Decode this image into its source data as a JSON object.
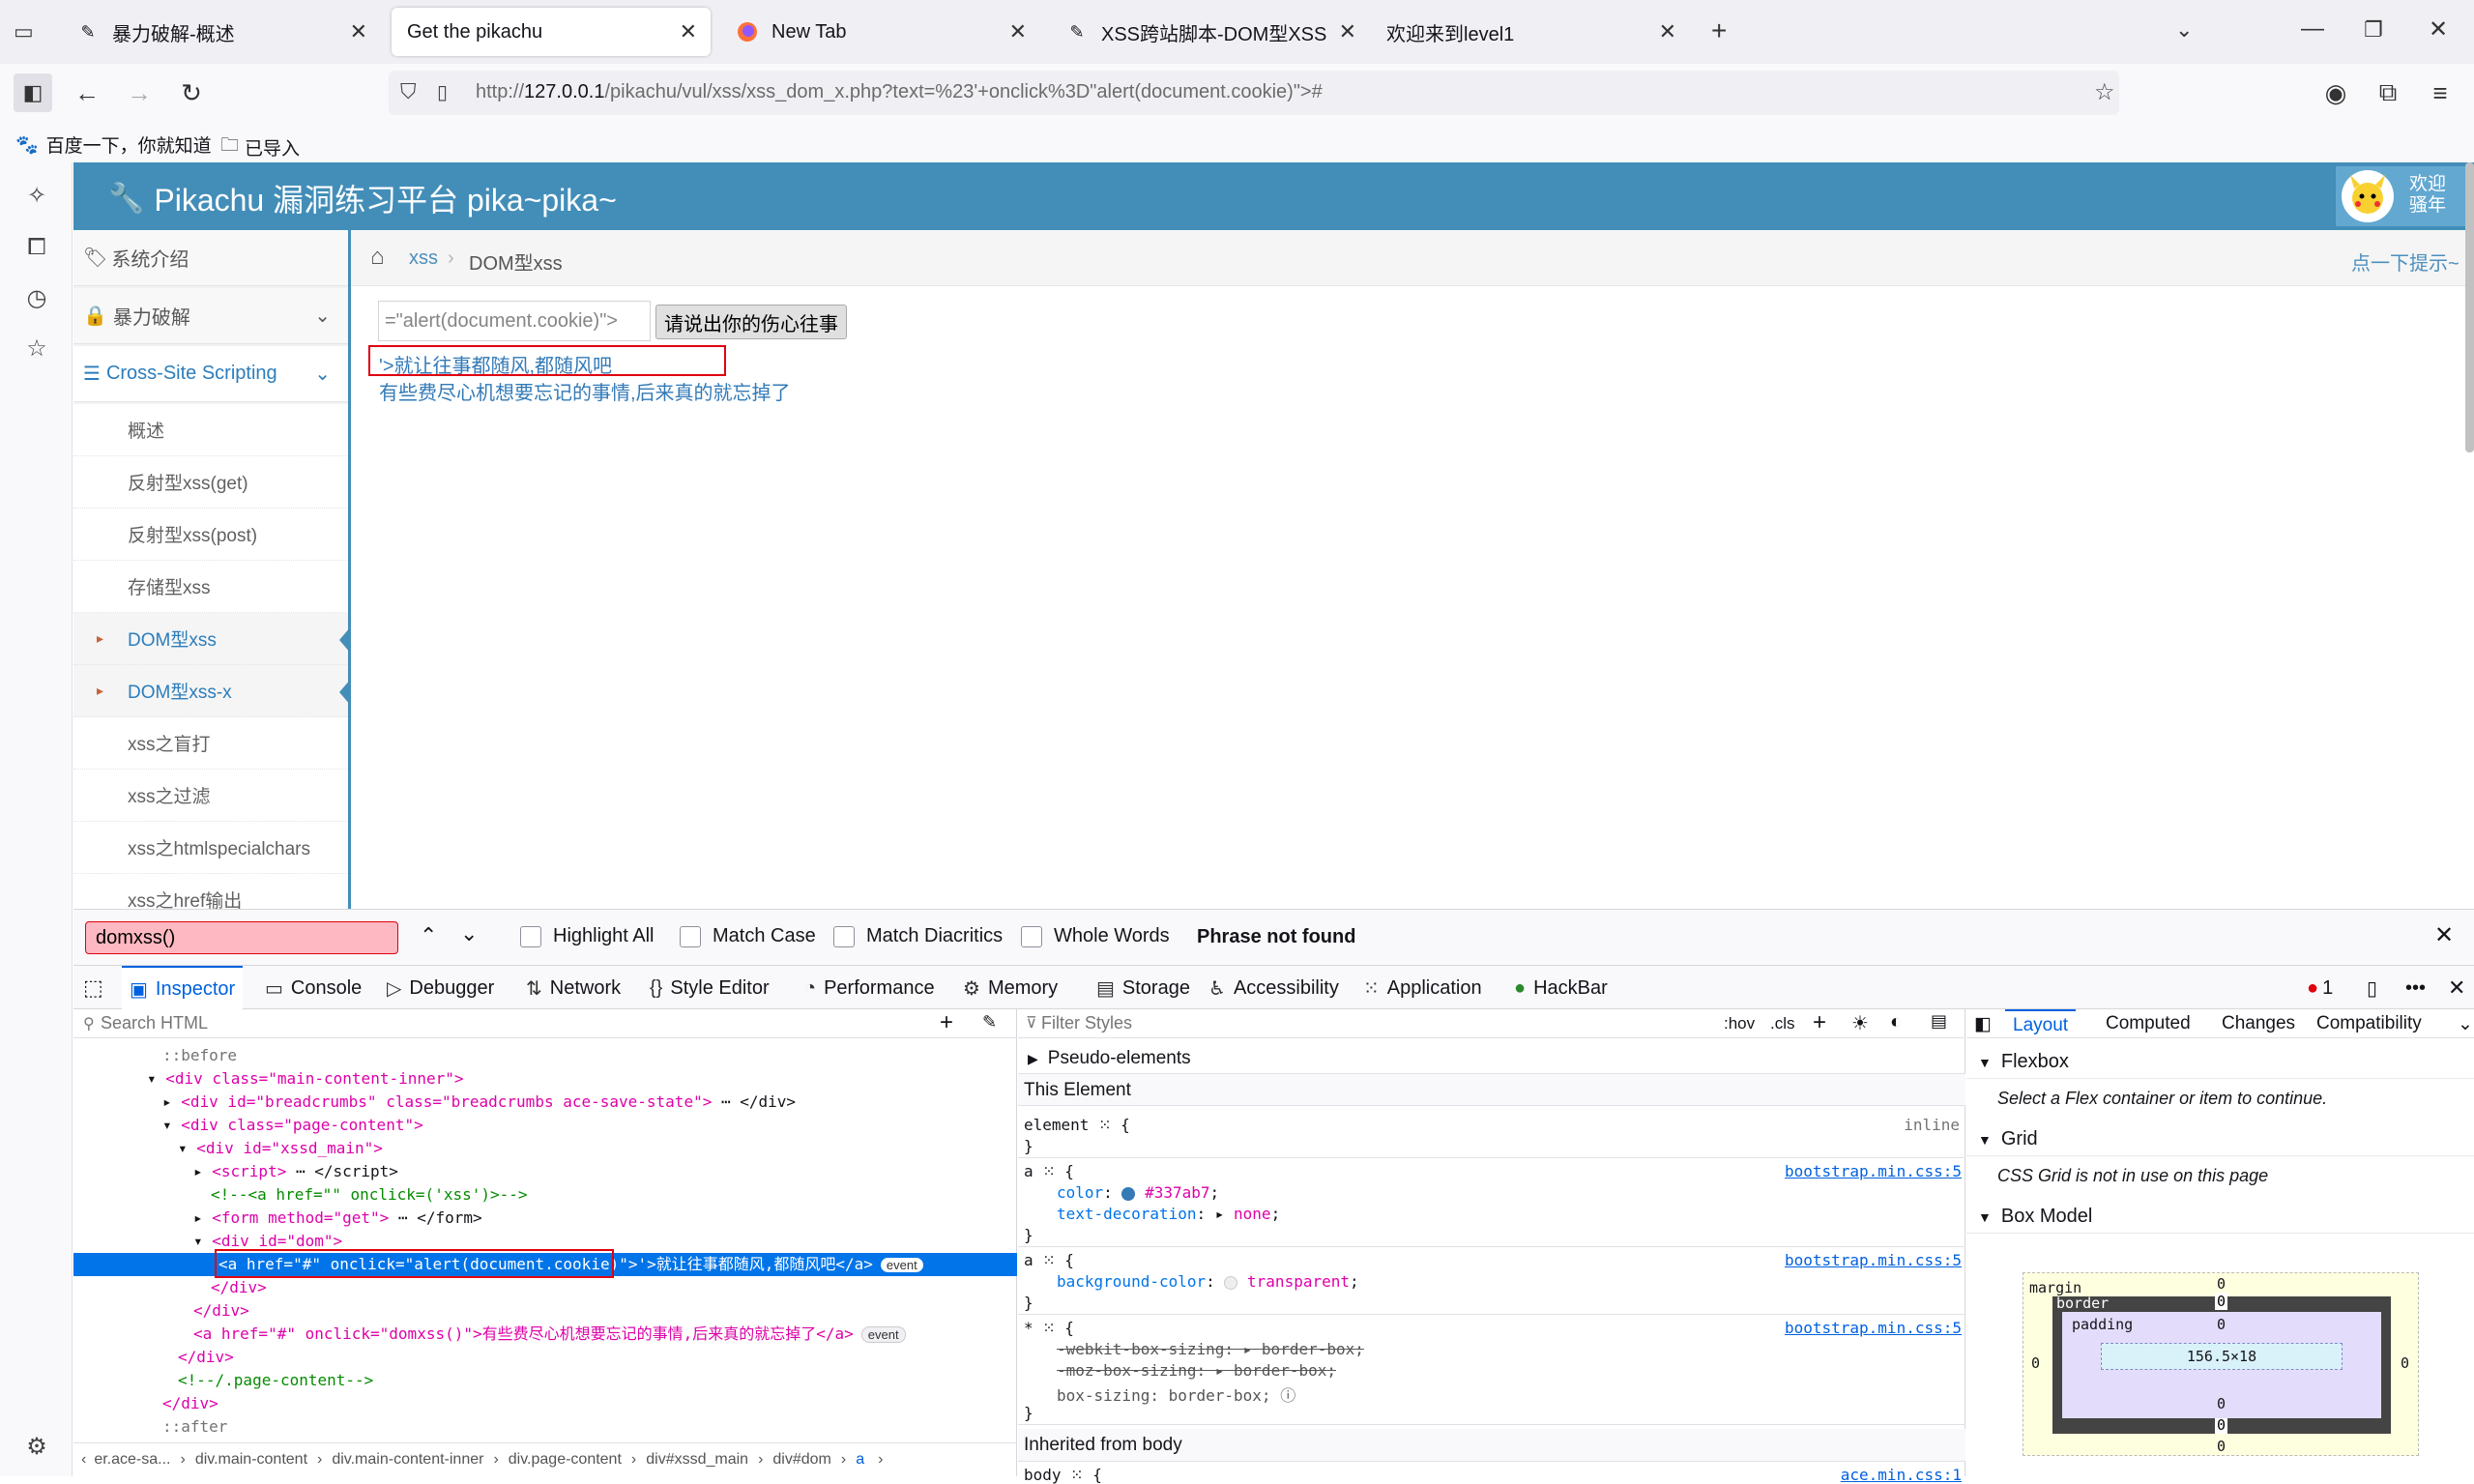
{
  "tabs": [
    {
      "title": "暴力破解-概述",
      "icon": "pikachu-icon"
    },
    {
      "title": "Get the pikachu",
      "icon": "none",
      "active": true
    },
    {
      "title": "New Tab",
      "icon": "firefox-icon"
    },
    {
      "title": "XSS跨站脚本-DOM型XSS",
      "icon": "pikachu-icon"
    },
    {
      "title": "欢迎来到level1",
      "icon": "none"
    }
  ],
  "url": {
    "prefix": "http://",
    "host": "127.0.0.1",
    "path": "/pikachu/vul/xss/xss_dom_x.php?text=%23'+onclick%3D\"alert(document.cookie)\">#"
  },
  "bookmarks": [
    {
      "label": "百度一下，你就知道"
    },
    {
      "label": "已导入"
    }
  ],
  "page": {
    "header_title": "Pikachu 漏洞练习平台 pika~pika~",
    "welcome_line1": "欢迎",
    "welcome_line2": "骚年",
    "menu": {
      "top": [
        {
          "label": "系统介绍"
        },
        {
          "label": "暴力破解"
        },
        {
          "label": "Cross-Site Scripting"
        }
      ],
      "subs": [
        "概述",
        "反射型xss(get)",
        "反射型xss(post)",
        "存储型xss",
        "DOM型xss",
        "DOM型xss-x",
        "xss之盲打",
        "xss之过滤",
        "xss之htmlspecialchars",
        "xss之href输出"
      ]
    },
    "breadcrumb": {
      "parent": "xss",
      "current": "DOM型xss",
      "hint": "点一下提示~"
    },
    "input_value": "=\"alert(document.cookie)\">",
    "submit_label": "请说出你的伤心往事",
    "link1": "'>就让往事都随风,都随风吧",
    "link2": "有些费尽心机想要忘记的事情,后来真的就忘掉了"
  },
  "findbar": {
    "query": "domxss()",
    "options": [
      "Highlight All",
      "Match Case",
      "Match Diacritics",
      "Whole Words"
    ],
    "status": "Phrase not found"
  },
  "devtools": {
    "tabs": [
      "Inspector",
      "Console",
      "Debugger",
      "Network",
      "Style Editor",
      "Performance",
      "Memory",
      "Storage",
      "Accessibility",
      "Application",
      "HackBar"
    ],
    "error_count": "1",
    "search_placeholder": "Search HTML",
    "filter_placeholder": "Filter Styles",
    "hov": ":hov",
    "cls": ".cls",
    "markup": {
      "before": "::before",
      "after": "::after",
      "div_main_inner": "<div class=\"main-content-inner\">",
      "breadcrumbs": "<div id=\"breadcrumbs\" class=\"breadcrumbs ace-save-state\">",
      "page_content": "<div class=\"page-content\">",
      "xssd_main": "<div id=\"xssd_main\">",
      "script": "<script>",
      "comment1": "<!--<a href=\"\" onclick=('xss')>-->",
      "form": "<form method=\"get\">",
      "div_dom": "<div id=\"dom\">",
      "a_selected": "<a href=\"#\" onclick=\"alert(document.cookie)\">",
      "a_selected_text": "'>就让往事都随风,都随风吧</a>",
      "close_div": "</div>",
      "a_domxss": "<a href=\"#\" onclick=\"domxss()\">有些费尽心机想要忘记的事情,后来真的就忘掉了</a>",
      "comment_page": "<!--/.page-content-->",
      "event": "event"
    },
    "breadcrumbs": [
      "er.ace-sa...",
      "div.main-content",
      "div.main-content-inner",
      "div.page-content",
      "div#xssd_main",
      "div#dom",
      "a"
    ],
    "rules": {
      "pseudo": "Pseudo-elements",
      "this_element": "This Element",
      "element_sel": "element",
      "inline": "inline",
      "source": "bootstrap.min.css:5",
      "color_prop": "color",
      "color_val": "#337ab7",
      "td_prop": "text-decoration",
      "td_val": "none",
      "bg_prop": "background-color",
      "bg_val": "transparent",
      "wk_prop": "-webkit-box-sizing",
      "wk_val": "border-box",
      "moz_prop": "-moz-box-sizing",
      "moz_val": "border-box",
      "bs_prop": "box-sizing",
      "bs_val": "border-box",
      "inherited": "Inherited from body",
      "body_source": "ace.min.css:1"
    },
    "layout_tabs": [
      "Layout",
      "Computed",
      "Changes",
      "Compatibility"
    ],
    "flexbox": "Flexbox",
    "flexbox_msg": "Select a Flex container or item to continue.",
    "grid": "Grid",
    "grid_msg": "CSS Grid is not in use on this page",
    "boxmodel": "Box Model",
    "box": {
      "margin": "margin",
      "border": "border",
      "padding": "padding",
      "content": "156.5×18",
      "zero": "0"
    }
  },
  "colors": {
    "accent": "#0061e0",
    "header": "#438eb9",
    "link": "#337ab7",
    "selection": "#0074e8",
    "highlight_red": "#e0000f"
  }
}
